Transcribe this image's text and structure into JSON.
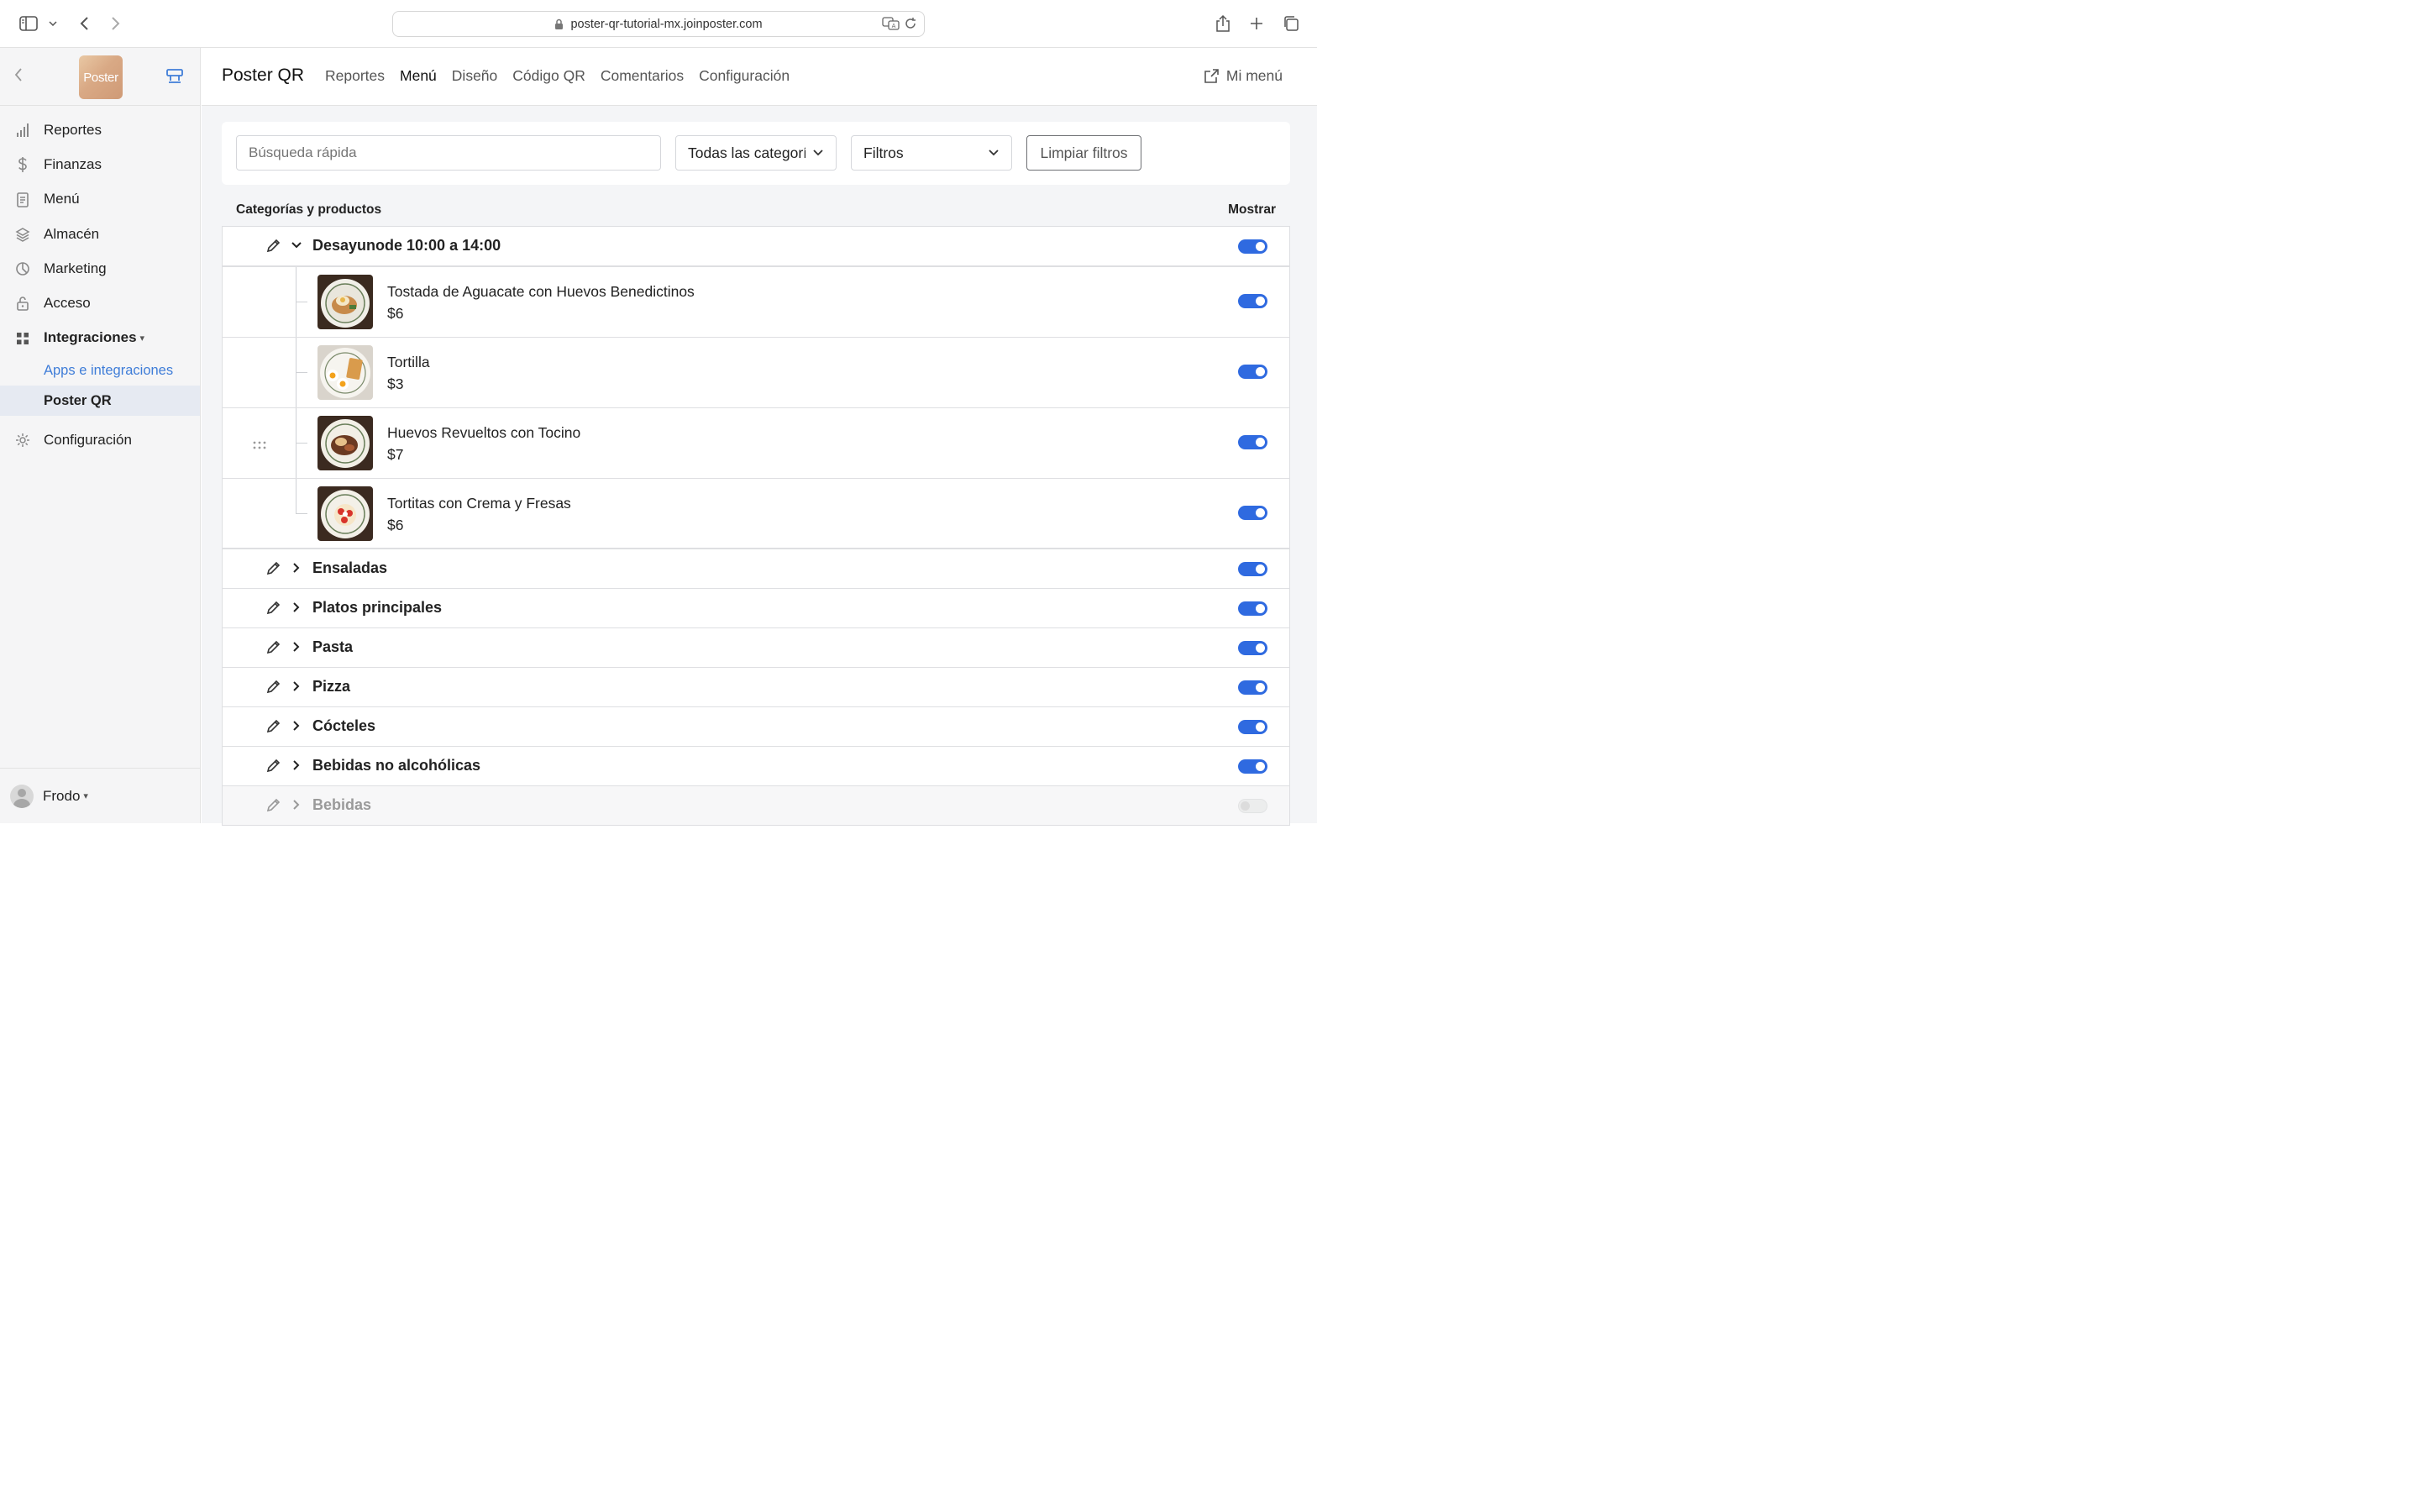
{
  "browser": {
    "url": "poster-qr-tutorial-mx.joinposter.com"
  },
  "sidebar": {
    "logo_text": "Poster",
    "items": [
      {
        "label": "Reportes",
        "icon": "bar-chart-icon"
      },
      {
        "label": "Finanzas",
        "icon": "dollar-icon"
      },
      {
        "label": "Menú",
        "icon": "document-icon"
      },
      {
        "label": "Almacén",
        "icon": "layers-icon"
      },
      {
        "label": "Marketing",
        "icon": "pie-icon"
      },
      {
        "label": "Acceso",
        "icon": "lock-icon"
      },
      {
        "label": "Integraciones",
        "icon": "grid-icon"
      }
    ],
    "subitems": [
      {
        "label": "Apps e integraciones"
      },
      {
        "label": "Poster QR"
      }
    ],
    "settings": {
      "label": "Configuración"
    },
    "user": {
      "name": "Frodo"
    }
  },
  "header": {
    "brand": "Poster QR",
    "tabs": [
      {
        "label": "Reportes"
      },
      {
        "label": "Menú"
      },
      {
        "label": "Diseño"
      },
      {
        "label": "Código QR"
      },
      {
        "label": "Comentarios"
      },
      {
        "label": "Configuración"
      }
    ],
    "active_tab": "Menú",
    "my_menu": "Mi menú"
  },
  "filters": {
    "search_placeholder": "Búsqueda rápida",
    "category_select": "Todas las categorías",
    "filter_select": "Filtros",
    "clear_label": "Limpiar filtros"
  },
  "list": {
    "title": "Categorías y productos",
    "show_label": "Mostrar",
    "expanded_category": {
      "name": "Desayunode 10:00 a 14:00",
      "visible": true,
      "products": [
        {
          "name": "Tostada de Aguacate con Huevos Benedictinos",
          "price": "$6",
          "visible": true
        },
        {
          "name": "Tortilla",
          "price": "$3",
          "visible": true
        },
        {
          "name": "Huevos Revueltos con Tocino",
          "price": "$7",
          "visible": true
        },
        {
          "name": "Tortitas con Crema y Fresas",
          "price": "$6",
          "visible": true
        }
      ]
    },
    "categories": [
      {
        "name": "Ensaladas",
        "visible": true
      },
      {
        "name": "Platos principales",
        "visible": true
      },
      {
        "name": "Pasta",
        "visible": true
      },
      {
        "name": "Pizza",
        "visible": true
      },
      {
        "name": "Cócteles",
        "visible": true
      },
      {
        "name": "Bebidas no alcohólicas",
        "visible": true
      },
      {
        "name": "Bebidas",
        "visible": false
      }
    ]
  },
  "colors": {
    "accent": "#2f6ae0",
    "link": "#3f7dd8",
    "sidebar_bg": "#f5f5f6"
  }
}
